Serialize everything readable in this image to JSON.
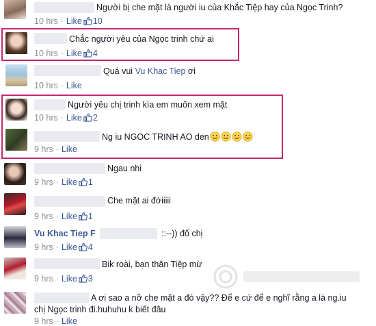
{
  "comments": [
    {
      "text": "Người bị che mặt là người iu của Khắc Tiệp hay của Ngọc Trinh?",
      "time": "10 hrs",
      "like_label": "Like",
      "likes": "10"
    },
    {
      "text": "Chắc người yêu của Ngọc trinh chứ ai",
      "time": "10 hrs",
      "like_label": "Like",
      "likes": "4"
    },
    {
      "text_pre": "Quá vui ",
      "mention": "Vu Khac Tiep",
      "text_post": " ơi",
      "time": "10 hrs",
      "like_label": "Like"
    },
    {
      "text": "Người yêu chị trinh kìa em muốn xem mặt",
      "time": "10 hrs",
      "like_label": "Like",
      "likes": "2"
    },
    {
      "text": "Ng iu NGOC TRINH AO den",
      "time": "9 hrs",
      "like_label": "Like"
    },
    {
      "text": "Ngau nhi",
      "time": "9 hrs",
      "like_label": "Like",
      "likes": "1"
    },
    {
      "text": "Che mặt ai đớiiiii",
      "time": "9 hrs",
      "like_label": "Like",
      "likes": "1"
    },
    {
      "author": "Vu Khac Tiep",
      "author_suffix": "F",
      "text": "::--)) đố chị",
      "time": "9 hrs",
      "like_label": "Like",
      "likes": "4"
    },
    {
      "text": "Bik roài, bạn thân Tiệp mừ",
      "time": "9 hrs",
      "like_label": "Like",
      "likes": "3"
    },
    {
      "text_line1": "A ơi sao a nỡ che mặt a đó vậy?? Để e cứ để e nghĩ rằng a là ng.iu",
      "text_line2": "chị Ngọc trinh đi.huhuhu k biết đâu",
      "time": "9 hrs",
      "like_label": "Like"
    }
  ],
  "colors": {
    "link": "#3b5998",
    "highlight": "#c5286d",
    "meta": "#8c8c8c"
  },
  "icons": [
    "like-thumb-icon",
    "smiley-icon",
    "watermark-logo"
  ]
}
